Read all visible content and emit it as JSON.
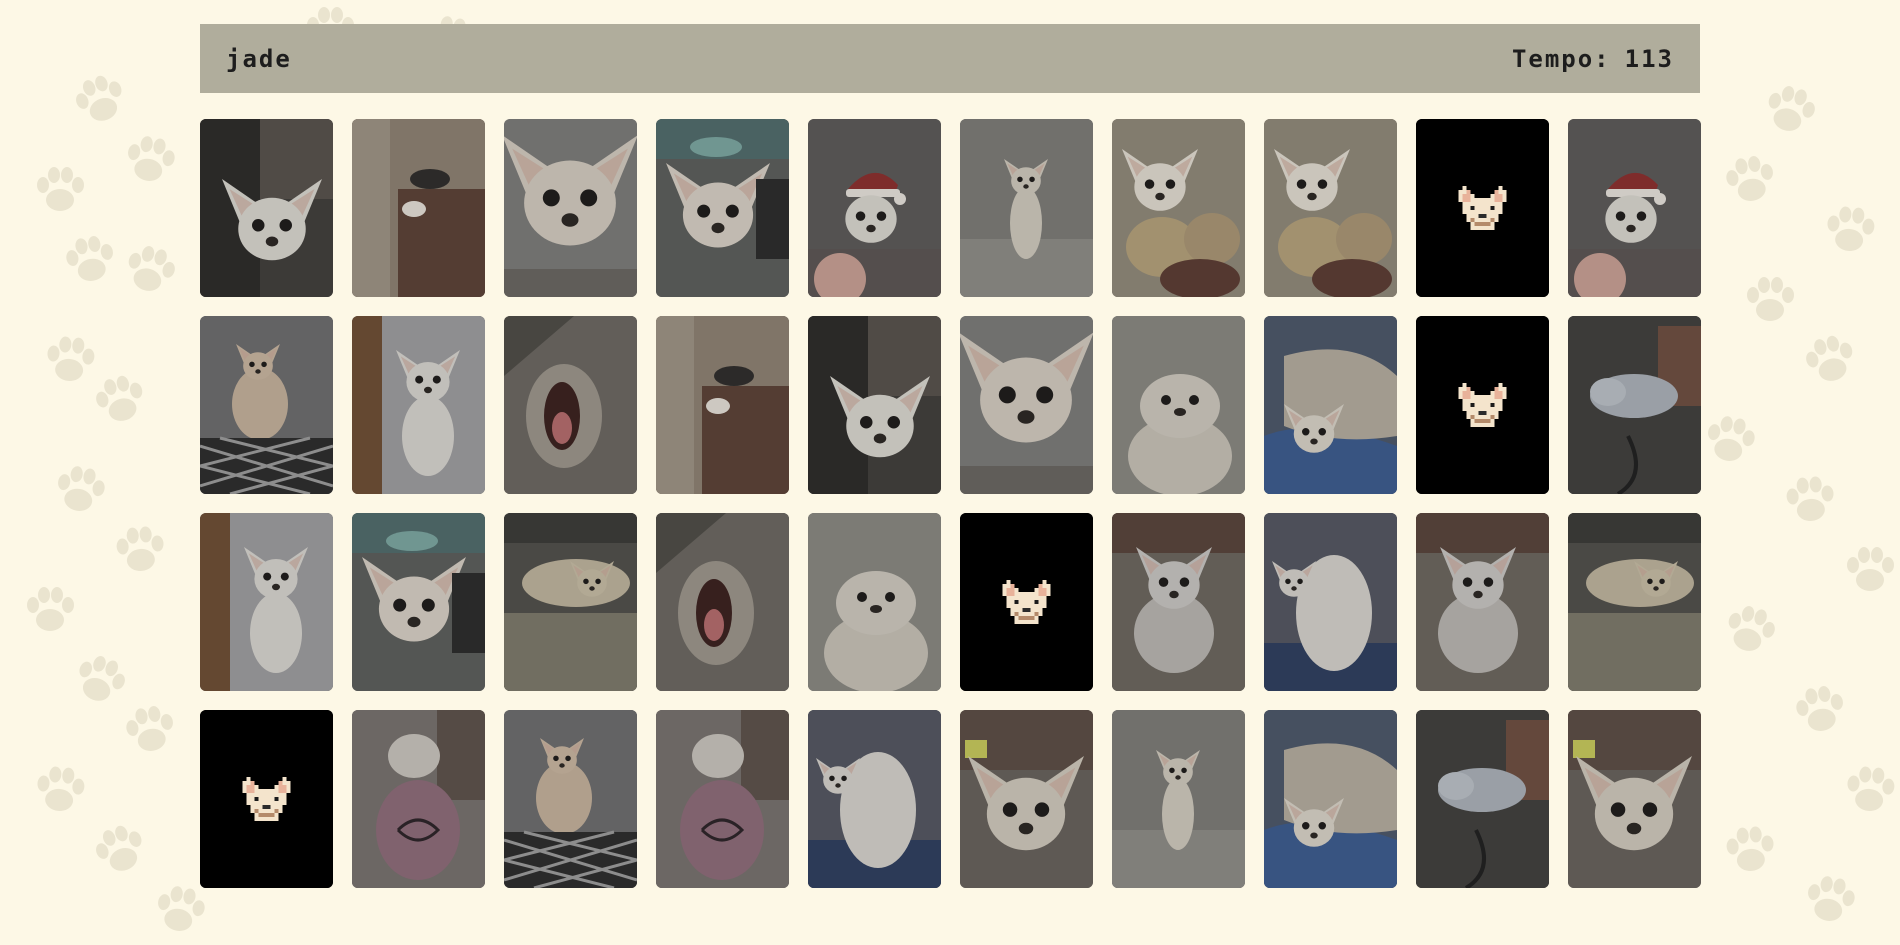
{
  "header": {
    "player_name": "jade",
    "timer_label": "Tempo:",
    "timer_value": "113"
  },
  "colors": {
    "background": "#fdf8e6",
    "header": "#b0ad9c",
    "card_back": "#000000"
  },
  "board": {
    "rows": [
      [
        {
          "state": "face-up",
          "motif": "dog-closeup-door",
          "bg": "#3f3d3a"
        },
        {
          "state": "face-up",
          "motif": "dog-on-couch",
          "bg": "#6a5e52"
        },
        {
          "state": "face-up",
          "motif": "dog-big-eyes",
          "bg": "#7a7a78"
        },
        {
          "state": "face-up",
          "motif": "dog-with-toy",
          "bg": "#5b5d5a"
        },
        {
          "state": "face-up",
          "motif": "dog-santa-hat",
          "bg": "#5a5857"
        },
        {
          "state": "face-up",
          "motif": "dog-standing-up",
          "bg": "#777672"
        },
        {
          "state": "face-up",
          "motif": "dog-with-plush",
          "bg": "#8b8576"
        },
        {
          "state": "face-up",
          "motif": "dog-with-plush",
          "bg": "#8b8576"
        },
        {
          "state": "face-down",
          "motif": "pixel-chihuahua-back",
          "bg": "#000000"
        },
        {
          "state": "face-up",
          "motif": "dog-santa-hat",
          "bg": "#5a5857"
        }
      ],
      [
        {
          "state": "face-up",
          "motif": "dog-side-cushion",
          "bg": "#5f5f61"
        },
        {
          "state": "face-up",
          "motif": "dog-sitting-floor",
          "bg": "#6d6a66"
        },
        {
          "state": "face-up",
          "motif": "dog-yawning",
          "bg": "#59564f"
        },
        {
          "state": "face-up",
          "motif": "dog-on-couch",
          "bg": "#6a5e52"
        },
        {
          "state": "face-up",
          "motif": "dog-closeup-door",
          "bg": "#3f3d3a"
        },
        {
          "state": "face-up",
          "motif": "dog-big-eyes",
          "bg": "#7a7a78"
        },
        {
          "state": "face-up",
          "motif": "dog-face-blur",
          "bg": "#807f7b"
        },
        {
          "state": "face-up",
          "motif": "dog-under-blanket",
          "bg": "#59606c"
        },
        {
          "state": "face-down",
          "motif": "pixel-chihuahua-back",
          "bg": "#000000"
        },
        {
          "state": "face-up",
          "motif": "dog-curled-bed",
          "bg": "#4b4a47"
        }
      ],
      [
        {
          "state": "face-up",
          "motif": "dog-sitting-floor",
          "bg": "#6d6a66"
        },
        {
          "state": "face-up",
          "motif": "dog-with-toy",
          "bg": "#5b5d5a"
        },
        {
          "state": "face-up",
          "motif": "dog-lying-rug",
          "bg": "#5a5953"
        },
        {
          "state": "face-up",
          "motif": "dog-yawning",
          "bg": "#59564f"
        },
        {
          "state": "face-up",
          "motif": "dog-face-blur",
          "bg": "#807f7b"
        },
        {
          "state": "face-down",
          "motif": "pixel-chihuahua-back",
          "bg": "#000000"
        },
        {
          "state": "face-up",
          "motif": "dog-ears-up-bed",
          "bg": "#64605a"
        },
        {
          "state": "face-up",
          "motif": "dog-back-view",
          "bg": "#4d5260"
        },
        {
          "state": "face-up",
          "motif": "dog-ears-up-bed",
          "bg": "#64605a"
        },
        {
          "state": "face-up",
          "motif": "dog-lying-rug",
          "bg": "#5a5953"
        }
      ],
      [
        {
          "state": "face-down",
          "motif": "pixel-chihuahua-back",
          "bg": "#000000"
        },
        {
          "state": "face-up",
          "motif": "dog-pink-sweater",
          "bg": "#736c6a"
        },
        {
          "state": "face-up",
          "motif": "dog-side-cushion",
          "bg": "#5f5f61"
        },
        {
          "state": "face-up",
          "motif": "dog-pink-sweater",
          "bg": "#736c6a"
        },
        {
          "state": "face-up",
          "motif": "dog-back-view",
          "bg": "#4d5260"
        },
        {
          "state": "face-up",
          "motif": "dog-front-face",
          "bg": "#66605a"
        },
        {
          "state": "face-up",
          "motif": "dog-standing-up",
          "bg": "#777672"
        },
        {
          "state": "face-up",
          "motif": "dog-under-blanket",
          "bg": "#59606c"
        },
        {
          "state": "face-up",
          "motif": "dog-curled-bed",
          "bg": "#4b4a47"
        },
        {
          "state": "face-up",
          "motif": "dog-front-face",
          "bg": "#66605a"
        }
      ]
    ]
  }
}
